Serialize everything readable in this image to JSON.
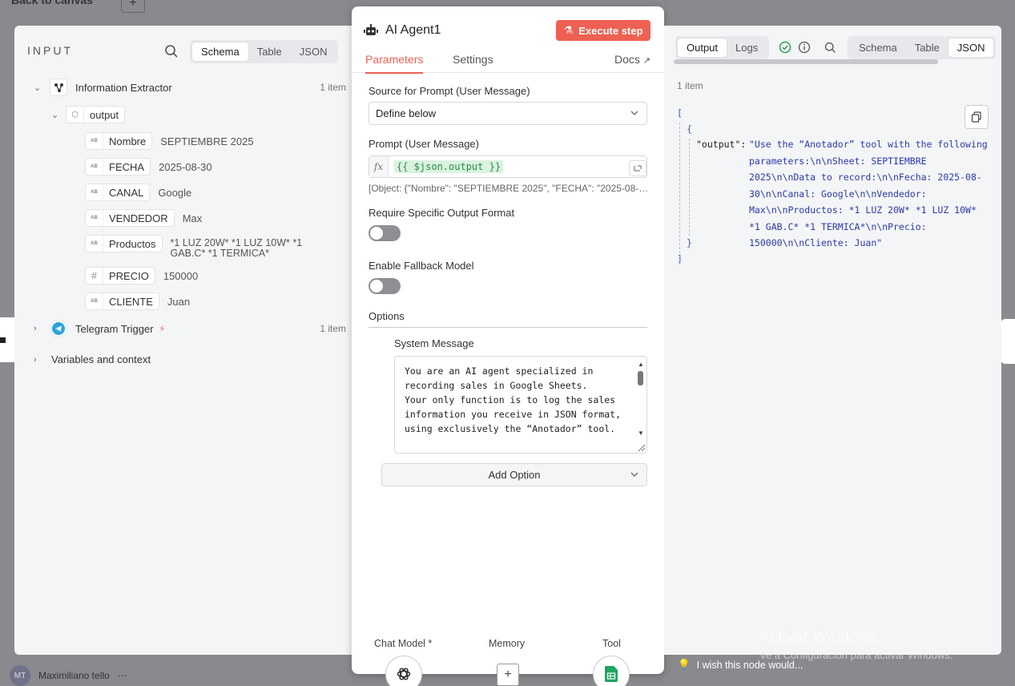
{
  "background": {
    "back_label": "Back to canvas",
    "user_initials": "MT",
    "user_name": "Maximiliano tello"
  },
  "input_panel": {
    "title": "INPUT",
    "view_tabs": [
      "Schema",
      "Table",
      "JSON"
    ],
    "active_view": "Schema",
    "nodes": [
      {
        "name": "Information Extractor",
        "count": "1 item",
        "expanded": true
      },
      {
        "name": "Telegram Trigger",
        "count": "1 item",
        "expanded": false
      }
    ],
    "output_key": "output",
    "fields": [
      {
        "type": "AB",
        "name": "Nombre",
        "value": "SEPTIEMBRE 2025"
      },
      {
        "type": "AB",
        "name": "FECHA",
        "value": "2025-08-30"
      },
      {
        "type": "AB",
        "name": "CANAL",
        "value": "Google"
      },
      {
        "type": "AB",
        "name": "VENDEDOR",
        "value": "Max"
      },
      {
        "type": "AB",
        "name": "Productos",
        "value": "*1 LUZ 20W* *1 LUZ 10W* *1 GAB.C* *1 TERMICA*"
      },
      {
        "type": "#",
        "name": "PRECIO",
        "value": "150000"
      },
      {
        "type": "AB",
        "name": "CLIENTE",
        "value": "Juan"
      }
    ],
    "variables_label": "Variables and context"
  },
  "node_panel": {
    "title": "AI Agent1",
    "execute_label": "Execute step",
    "tabs": [
      "Parameters",
      "Settings"
    ],
    "active_tab": "Parameters",
    "docs_label": "Docs",
    "source_label": "Source for Prompt (User Message)",
    "source_value": "Define below",
    "prompt_label": "Prompt (User Message)",
    "prompt_fx": "fx",
    "prompt_expression": "{{ $json.output }}",
    "prompt_preview": "[Object: {\"Nombre\": \"SEPTIEMBRE 2025\", \"FECHA\": \"2025-08-30\", \"CANAL\": \"Google\"",
    "require_format_label": "Require Specific Output Format",
    "require_format_on": false,
    "fallback_label": "Enable Fallback Model",
    "fallback_on": false,
    "options_label": "Options",
    "system_message_label": "System Message",
    "system_message": "You are an AI agent specialized in recording sales in Google Sheets.\nYour only function is to log the sales information you receive in JSON format, using exclusively the “Anotador” tool.\n\n## Instructions",
    "add_option_label": "Add Option",
    "sub_nodes": [
      {
        "label": "Chat Model *",
        "icon": "openai-icon"
      },
      {
        "label": "Memory",
        "icon": "plus-icon"
      },
      {
        "label": "Tool",
        "icon": "google-sheets-icon"
      }
    ]
  },
  "output_panel": {
    "tabs": [
      "Output",
      "Logs"
    ],
    "active_tab": "Output",
    "view_tabs": [
      "Schema",
      "Table",
      "JSON"
    ],
    "active_view": "JSON",
    "item_count": "1 item",
    "json_key": "\"output\":",
    "json_value": "\"Use the “Anotador” tool with the following parameters:\\n\\nSheet: SEPTIEMBRE 2025\\n\\nData to record:\\n\\nFecha: 2025-08-30\\n\\nCanal: Google\\n\\nVendedor: Max\\n\\nProductos: *1 LUZ 20W* *1 LUZ 10W* *1 GAB.C* *1 TERMICA*\\n\\nPrecio: 150000\\n\\nCliente: Juan\""
  },
  "footer": {
    "wish_label": "I wish this node would...",
    "watermark_title": "Activar Windows",
    "watermark_sub": "Ve a Configuración para activar Windows."
  },
  "colors": {
    "accent": "#ee6052",
    "success": "#2e9e57",
    "json_string": "#2b3aa8"
  }
}
